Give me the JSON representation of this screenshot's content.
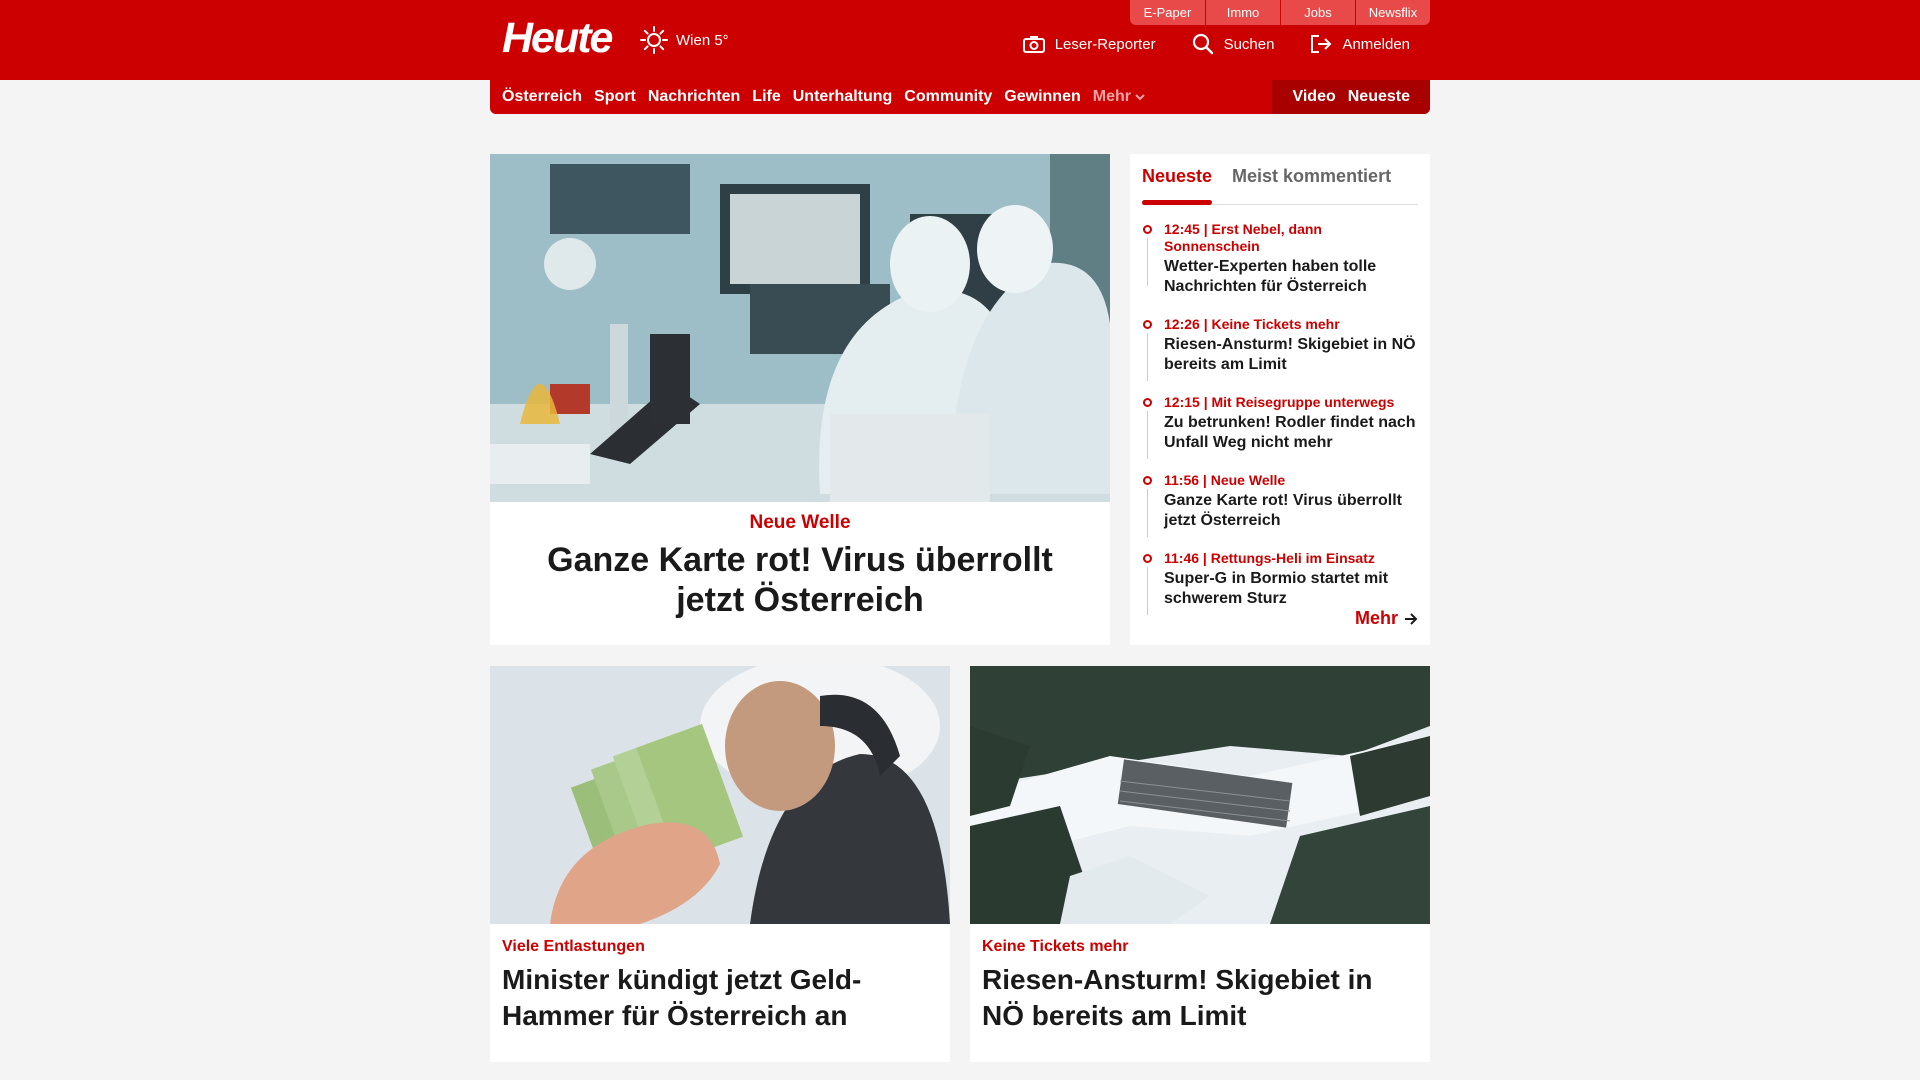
{
  "utility_links": [
    "E-Paper",
    "Immo",
    "Jobs",
    "Newsflix"
  ],
  "brand": {
    "logo": "Heute"
  },
  "weather": {
    "city_temp": "Wien 5°"
  },
  "header_actions": {
    "reporter": "Leser-Reporter",
    "search": "Suchen",
    "login": "Anmelden"
  },
  "nav": {
    "items": [
      "Österreich",
      "Sport",
      "Nachrichten",
      "Life",
      "Unterhaltung",
      "Community",
      "Gewinnen"
    ],
    "more": "Mehr",
    "video": "Video",
    "latest": "Neueste"
  },
  "lead": {
    "kicker": "Neue Welle",
    "title": "Ganze Karte rot! Virus überrollt jetzt Österreich"
  },
  "sidebar": {
    "tabs": [
      "Neueste",
      "Meist kommentiert"
    ],
    "items": [
      {
        "meta": "12:45 | Erst Nebel, dann Sonnenschein",
        "headline": "Wetter-Experten haben tolle Nachrichten für Österreich"
      },
      {
        "meta": "12:26 | Keine Tickets mehr",
        "headline": "Riesen-Ansturm! Skigebiet in NÖ bereits am Limit"
      },
      {
        "meta": "12:15 | Mit Reisegruppe unterwegs",
        "headline": "Zu betrunken! Rodler findet nach Unfall Weg nicht mehr"
      },
      {
        "meta": "11:56 | Neue Welle",
        "headline": "Ganze Karte rot! Virus überrollt jetzt Österreich"
      },
      {
        "meta": "11:46 | Rettungs-Heli im Einsatz",
        "headline": "Super-G in Bormio startet mit schwerem Sturz"
      }
    ],
    "more": "Mehr"
  },
  "cards": [
    {
      "kicker": "Viele Entlastungen",
      "title": "Minister kündigt jetzt Geld-Hammer für Österreich an"
    },
    {
      "kicker": "Keine Tickets mehr",
      "title": "Riesen-Ansturm! Skigebiet in NÖ bereits am Limit"
    }
  ],
  "colors": {
    "brand_red": "#cc0000",
    "dark_red": "#a80000",
    "background": "#f4f4f4"
  }
}
